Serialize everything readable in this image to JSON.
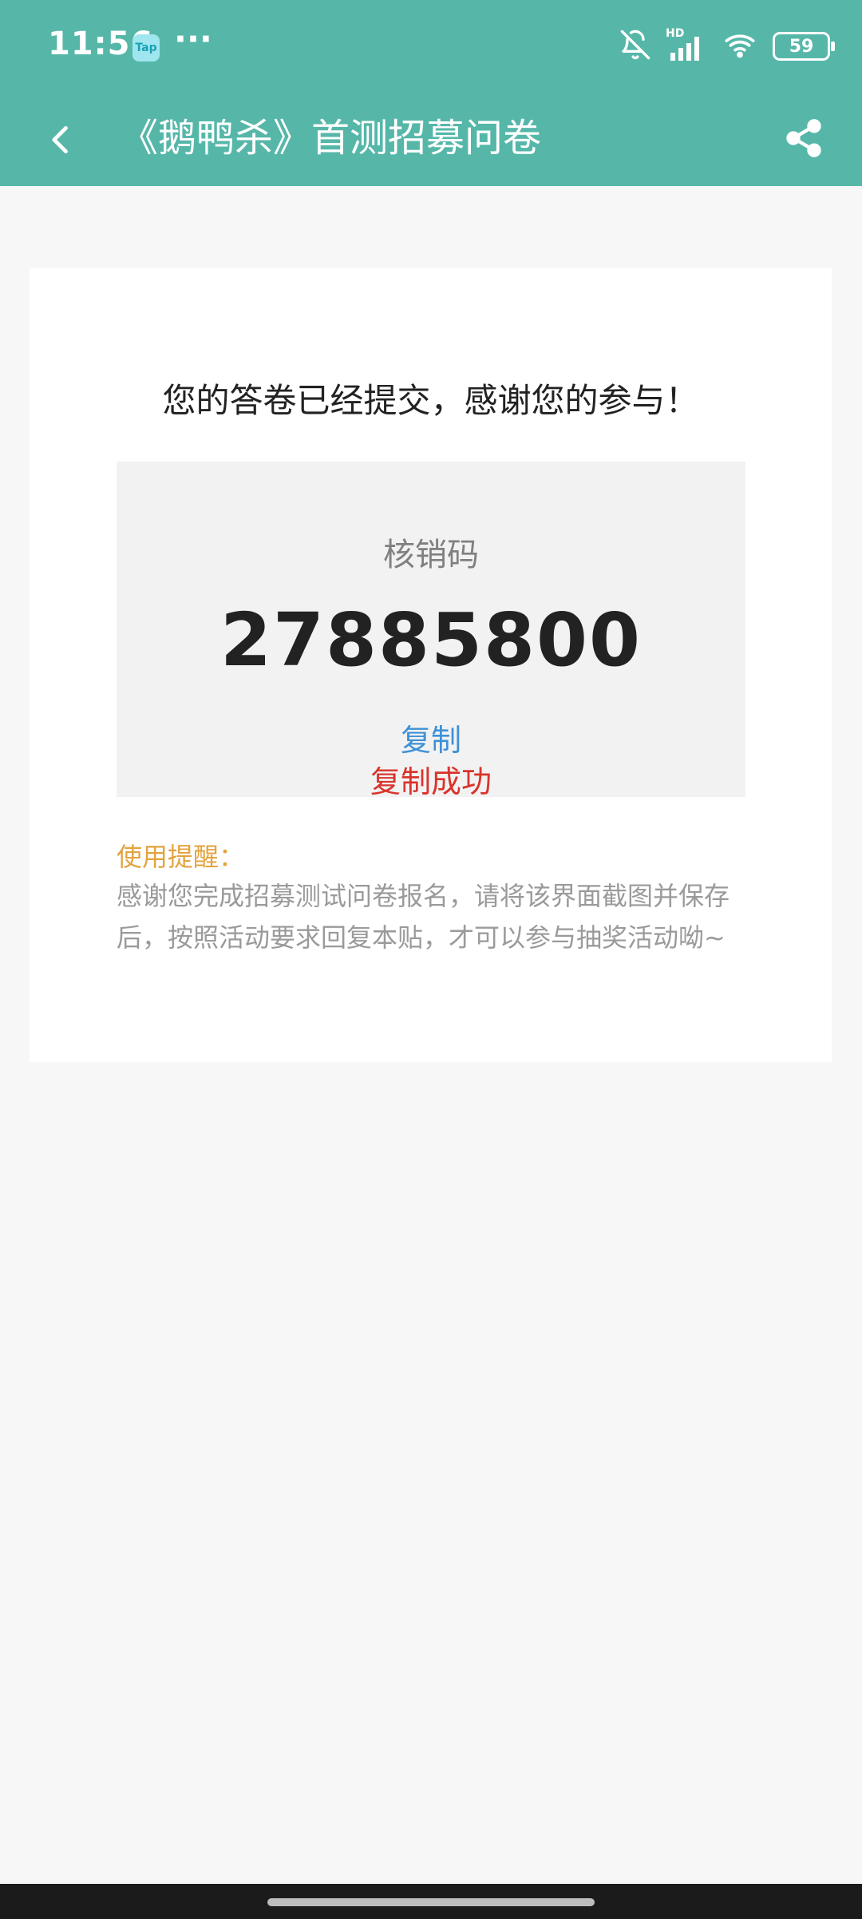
{
  "status_bar": {
    "time": "11:56",
    "app_badge": "Tap",
    "overflow_dots": "···",
    "network": "HD",
    "battery": "59"
  },
  "app_bar": {
    "title": "《鹅鸭杀》首测招募问卷"
  },
  "card": {
    "headline": "您的答卷已经提交，感谢您的参与！",
    "code_label": "核销码",
    "code_value": "27885800",
    "copy_label": "复制",
    "copy_success": "复制成功",
    "reminder_title": "使用提醒：",
    "reminder_body": "感谢您完成招募测试问卷报名，请将该界面截图并保存后，按照活动要求回复本贴，才可以参与抽奖活动呦~"
  },
  "colors": {
    "header_bg": "#56b7a9",
    "copy_link": "#3e90d6",
    "success_text": "#d8342c",
    "reminder_title": "#e3a33e"
  },
  "icons": {
    "back": "back-arrow-icon",
    "share": "share-icon",
    "mute": "bell-off-icon",
    "signal": "signal-icon",
    "wifi": "wifi-icon"
  }
}
